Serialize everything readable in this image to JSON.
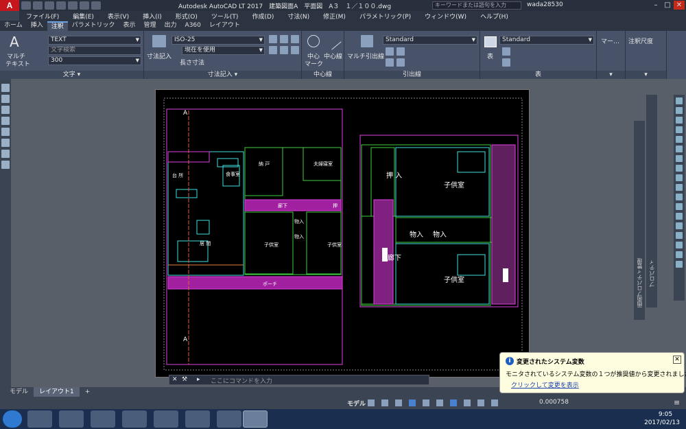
{
  "titlebar": {
    "logo": "A",
    "logo_sub": "LT",
    "title": "Autodesk AutoCAD LT 2017　建築図面A　平面図　A３　１／１００.dwg",
    "search_placeholder": "キーワードまたは語句を入力",
    "user": "wada28530"
  },
  "menu": [
    "ファイル(F)",
    "編集(E)",
    "表示(V)",
    "挿入(I)",
    "形式(O)",
    "ツール(T)",
    "作成(D)",
    "寸法(N)",
    "修正(M)",
    "パラメトリック(P)",
    "ウィンドウ(W)",
    "ヘルプ(H)"
  ],
  "tabs": [
    "ホーム",
    "挿入",
    "注釈",
    "パラメトリック",
    "表示",
    "管理",
    "出力",
    "A360",
    "レイアウト"
  ],
  "active_tab": "注釈",
  "ribbon": {
    "text_panel": {
      "big_label_1": "マルチ",
      "big_label_2": "テキスト",
      "style": "TEXT",
      "search": "文字検索",
      "height": "300",
      "footer": "文字 ▾"
    },
    "dim_panel": {
      "big_label": "寸法記入",
      "style": "ISO-25",
      "layer": "現在を使用",
      "sub": "長さ寸法",
      "footer": "寸法記入 ▾"
    },
    "center_panel": {
      "label1": "中心",
      "label1b": "マーク",
      "label2": "中心線",
      "footer": "中心線"
    },
    "leader_panel": {
      "big_label": "マルチ引出線",
      "style": "Standard",
      "footer": "引出線"
    },
    "table_panel": {
      "big_label": "表",
      "style": "Standard",
      "footer": "表"
    },
    "markup_panel": {
      "label": "マー…"
    },
    "scale_panel": {
      "label": "注釈尺度"
    }
  },
  "drawing": {
    "rooms_left": [
      "台 所",
      "食事室",
      "納 戸",
      "夫婦寝室",
      "廊下",
      "押",
      "居 間",
      "物入",
      "物入",
      "子供室",
      "子供室"
    ],
    "rooms_right": [
      "押 入",
      "子供室",
      "物入",
      "物入",
      "廊下",
      "子供室"
    ],
    "section_marks": [
      "A",
      "A"
    ],
    "porch": "ポーチ"
  },
  "right_palettes": {
    "props1": "画面プロパティ管理",
    "props2": "プロパティ"
  },
  "command": {
    "placeholder": "ここにコマンドを入力"
  },
  "layout_tabs": [
    "モデル",
    "レイアウト1"
  ],
  "active_layout": "レイアウト1",
  "status": {
    "model": "モデル",
    "value": "0.000758"
  },
  "balloon": {
    "title": "変更されたシステム変数",
    "message": "モニタされているシステム変数の１つが推奨値から変更されました",
    "link": "クリックして変更を表示"
  },
  "taskbar": {
    "time": "9:05",
    "date": "2017/02/13"
  },
  "colors": {
    "accent": "#c4161c",
    "magenta": "#e040e0",
    "green": "#40d040",
    "cyan": "#40e0e0",
    "yellow": "#e0e040"
  }
}
